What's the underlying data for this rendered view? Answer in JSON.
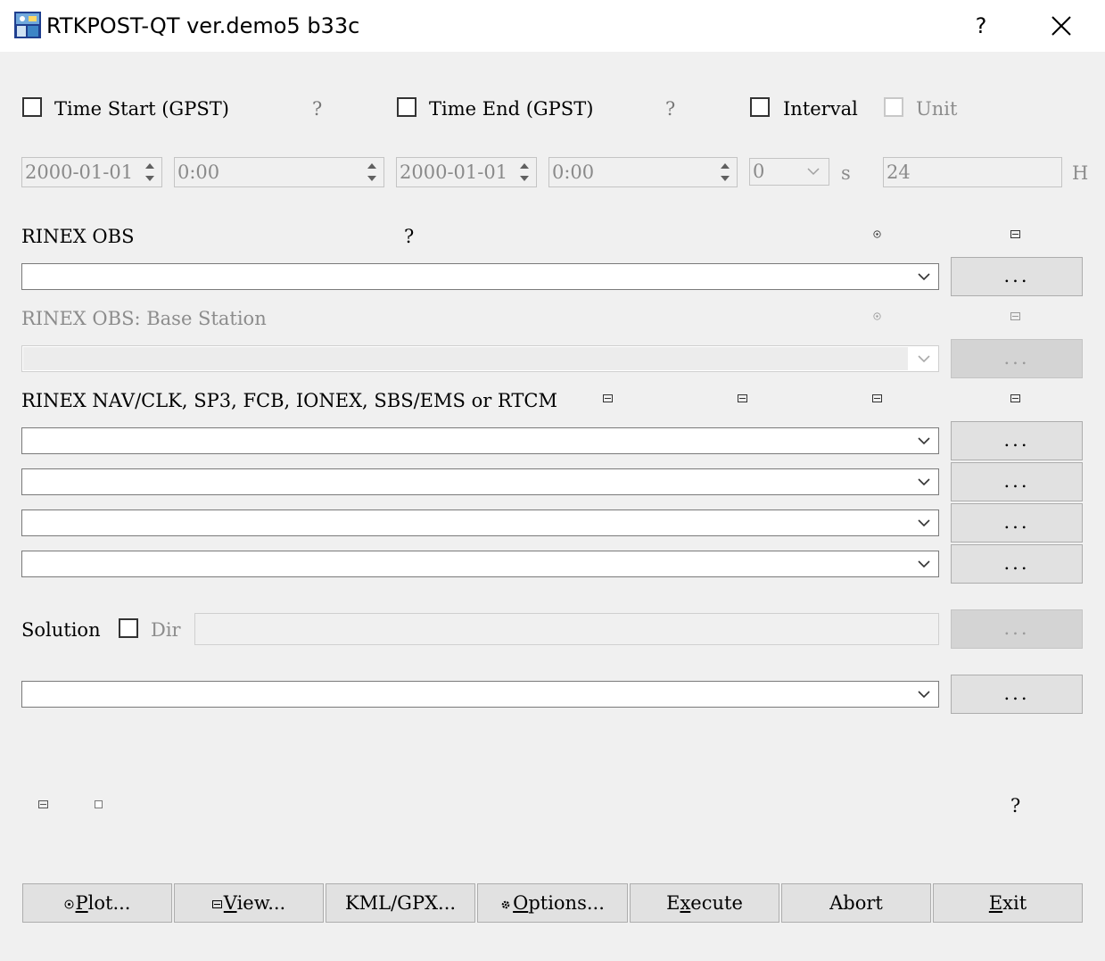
{
  "window": {
    "title": "RTKPOST-QT ver.demo5 b33c",
    "help_glyph": "?",
    "close_icon": "close-icon"
  },
  "time": {
    "start_label": "Time Start (GPST)",
    "start_help": "?",
    "end_label": "Time End (GPST)",
    "end_help": "?",
    "interval_label": "Interval",
    "unit_label": "Unit",
    "start_date": "2000-01-01",
    "start_time": "0:00",
    "end_date": "2000-01-01",
    "end_time": "0:00",
    "interval_value": "0",
    "interval_suffix": "s",
    "unit_value": "24",
    "unit_suffix": "H"
  },
  "rover": {
    "label": "RINEX OBS",
    "help": "?",
    "browse_label": "..."
  },
  "base": {
    "label": "RINEX OBS: Base Station",
    "browse_label": "..."
  },
  "nav": {
    "label": "RINEX NAV/CLK, SP3, FCB, IONEX, SBS/EMS  or RTCM",
    "browse_labels": [
      "...",
      "...",
      "...",
      "..."
    ]
  },
  "solution": {
    "label": "Solution",
    "dir_label": "Dir",
    "browse_dir_label": "...",
    "browse_out_label": "..."
  },
  "status": {
    "help": "?"
  },
  "buttons": {
    "plot": "Plot...",
    "view": "View...",
    "kml": "KML/GPX...",
    "options": "Options...",
    "execute_pre": "E",
    "execute_u": "x",
    "execute_post": "ecute",
    "abort": "Abort",
    "exit_u": "E",
    "exit_post": "xit",
    "plot_u": "P",
    "plot_post": "lot...",
    "view_u": "V",
    "view_post": "iew...",
    "options_u": "O",
    "options_post": "ptions..."
  },
  "colors": {
    "window_bg": "#f0f0f0",
    "titlebar_bg": "#ffffff",
    "disabled_text": "#8c8c8c"
  }
}
